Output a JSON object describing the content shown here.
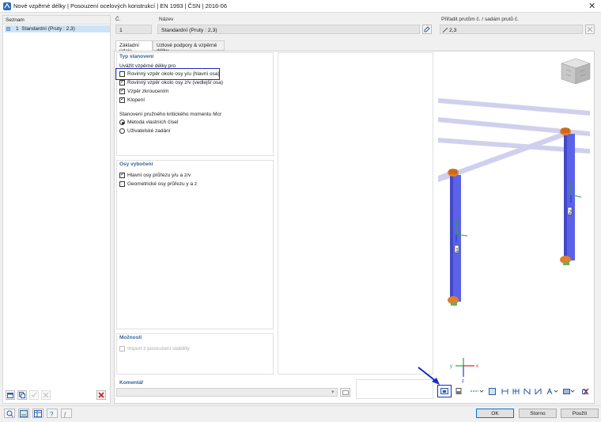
{
  "window": {
    "title": "Nové vzpěrné délky | Posouzení ocelových konstrukcí | EN 1993 | ČSN | 2016-06",
    "close_glyph": "✕"
  },
  "list": {
    "header": "Seznam",
    "items": [
      {
        "number": "1",
        "label": "Standardní (Pruty : 2,3)"
      }
    ]
  },
  "fields": {
    "no_label": "Č.",
    "no_value": "1",
    "name_label": "Název",
    "name_value": "Standardní (Pruty : 2,3)",
    "assign_label": "Přiřadit prutům č. / sadám prutů č.",
    "assign_value": "2,3"
  },
  "tabs": [
    "Základní údaje",
    "Uzlové podpory & vzpěrné délky"
  ],
  "sections": {
    "type": {
      "title": "Typ stanovení",
      "subtitle": "Uvážit vzpěrné délky pro",
      "options": [
        {
          "label": "Rovinný vzpěr okolo osy y/u (hlavní osa)",
          "checked": false
        },
        {
          "label": "Rovinný vzpěr okolo osy z/v (vedlejší osa)",
          "checked": true
        },
        {
          "label": "Vzpěr zkroucením",
          "checked": true
        },
        {
          "label": "Klopení",
          "checked": true
        }
      ],
      "mcr_title": "Stanovení pružného kritického momentu Mcr",
      "radios": [
        {
          "label": "Metoda vlastních čísel",
          "selected": true
        },
        {
          "label": "Uživatelské zadání",
          "selected": false
        }
      ]
    },
    "axes": {
      "title": "Osy vybočení",
      "options": [
        {
          "label": "Hlavní osy průřezu y/u a z/v",
          "checked": true
        },
        {
          "label": "Geometrické osy průřezu y a z",
          "checked": false
        }
      ]
    },
    "options": {
      "title": "Možnosti",
      "items": [
        {
          "label": "Import z posouzení stability",
          "checked": false
        }
      ]
    },
    "comment": {
      "title": "Komentář",
      "value": ""
    }
  },
  "view": {
    "member_labels": [
      "1",
      "2"
    ],
    "axis_labels": {
      "x": "x",
      "y": "y",
      "z": "z"
    }
  },
  "buttons": {
    "ok": "OK",
    "cancel": "Storno",
    "apply": "Použít"
  },
  "colors": {
    "member": "#5b62e8",
    "support": "#e07f2c",
    "beam": "#c9c9ee",
    "highlight": "#1a28c8",
    "list_selection": "#cce4f7"
  }
}
